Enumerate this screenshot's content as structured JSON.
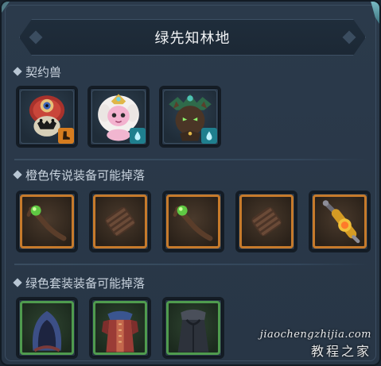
{
  "title": "绿先知林地",
  "sections": [
    {
      "label": "契约兽"
    },
    {
      "label": "橙色传说装备可能掉落"
    },
    {
      "label": "绿色套装装备可能掉落"
    }
  ],
  "pets": [
    {
      "name": "red-hooded-beast",
      "badge": "orange",
      "badge_icon": "boot-icon"
    },
    {
      "name": "pink-mage-spirit",
      "badge": "teal",
      "badge_icon": "water-drop-icon"
    },
    {
      "name": "forest-treant",
      "badge": "teal",
      "badge_icon": "water-drop-icon"
    }
  ],
  "orange_items": [
    {
      "icon": "green-orb-staff-icon"
    },
    {
      "icon": "bracer-icon"
    },
    {
      "icon": "green-orb-staff-icon"
    },
    {
      "icon": "bracer-icon"
    },
    {
      "icon": "golden-scepter-icon"
    }
  ],
  "green_items": [
    {
      "icon": "hood-icon"
    },
    {
      "icon": "red-robe-icon"
    },
    {
      "icon": "dark-cloak-icon"
    }
  ],
  "watermark": {
    "url": "jiaochengzhijia.com",
    "text": "教程之家"
  },
  "colors": {
    "orange_frame": "#c67a2b",
    "green_frame": "#4f9b4e",
    "panel": "#2b3a4b"
  }
}
